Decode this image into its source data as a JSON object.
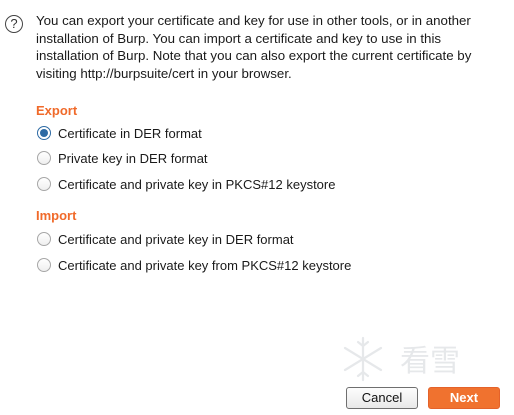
{
  "help_icon": "question-circle-icon",
  "intro_text": "You can export your certificate and key for use in other tools, or in another installation of Burp. You can import a certificate and key to use in this installation of Burp. Note that you can also export the current certificate by visiting http://burpsuite/cert in your browser.",
  "export": {
    "title": "Export",
    "options": [
      {
        "label": "Certificate in DER format",
        "checked": true
      },
      {
        "label": "Private key in DER format",
        "checked": false
      },
      {
        "label": "Certificate and private key in PKCS#12 keystore",
        "checked": false
      }
    ]
  },
  "import": {
    "title": "Import",
    "options": [
      {
        "label": "Certificate and private key in DER format",
        "checked": false
      },
      {
        "label": "Certificate and private key from PKCS#12 keystore",
        "checked": false
      }
    ]
  },
  "buttons": {
    "cancel": "Cancel",
    "next": "Next"
  },
  "watermark_text": "看雪",
  "colors": {
    "accent": "#f06a2a",
    "radio_selected": "#2d6aa4",
    "next_button": "#f0722f"
  }
}
